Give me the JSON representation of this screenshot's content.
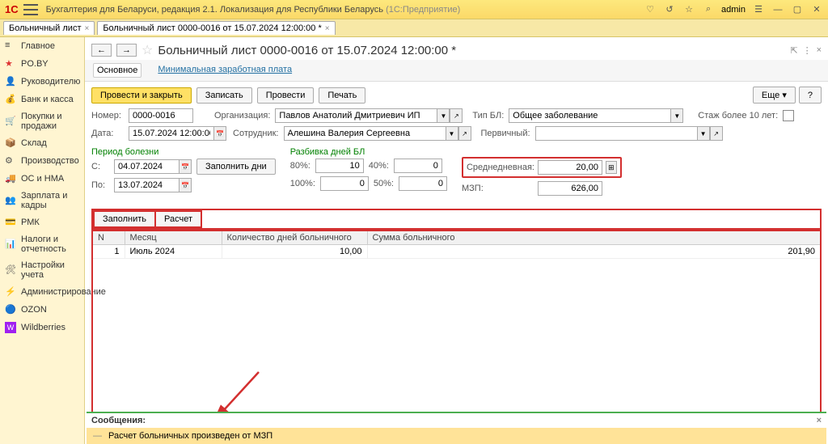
{
  "top": {
    "app": "Бухгалтерия для Беларуси, редакция 2.1. Локализация для Республики Беларусь",
    "suffix": "(1С:Предприятие)",
    "user": "admin"
  },
  "tabs": [
    "Больничный лист",
    "Больничный лист 0000-0016 от 15.07.2024 12:00:00 *"
  ],
  "sidebar": [
    "Главное",
    "PO.BY",
    "Руководителю",
    "Банк и касса",
    "Покупки и продажи",
    "Склад",
    "Производство",
    "ОС и НМА",
    "Зарплата и кадры",
    "РМК",
    "Налоги и отчетность",
    "Настройки учета",
    "Администрирование",
    "OZON",
    "Wildberries"
  ],
  "page_title": "Больничный лист 0000-0016 от 15.07.2024 12:00:00 *",
  "subtabs": {
    "main": "Основное",
    "link": "Минимальная заработная плата"
  },
  "buttons": {
    "post_close": "Провести и закрыть",
    "save": "Записать",
    "post": "Провести",
    "print": "Печать",
    "more": "Еще",
    "help": "?",
    "fill_days": "Заполнить дни",
    "fill": "Заполнить",
    "calc": "Расчет"
  },
  "labels": {
    "number": "Номер:",
    "date": "Дата:",
    "org": "Организация:",
    "emp": "Сотрудник:",
    "type": "Тип БЛ:",
    "primary": "Первичный:",
    "stazh": "Стаж более 10 лет:",
    "period": "Период болезни",
    "split": "Разбивка дней БЛ",
    "from": "С:",
    "to": "По:",
    "p80": "80%:",
    "p100": "100%:",
    "p40": "40%:",
    "p50": "50%:",
    "avg": "Среднедневная:",
    "mzp": "МЗП:"
  },
  "values": {
    "number": "0000-0016",
    "date": "15.07.2024 12:00:00",
    "org": "Павлов Анатолий Дмитриевич ИП",
    "emp": "Алешина Валерия Сергеевна",
    "type": "Общее заболевание",
    "primary": "",
    "from": "04.07.2024",
    "to": "13.07.2024",
    "p80": "10",
    "p100": "0",
    "p40": "0",
    "p50": "0",
    "avg": "20,00",
    "mzp": "626,00"
  },
  "grid": {
    "headers": [
      "N",
      "Месяц",
      "Количество дней больничного",
      "Сумма больничного"
    ],
    "rows": [
      {
        "n": "1",
        "month": "Июль 2024",
        "days": "10,00",
        "sum": "201,90"
      }
    ]
  },
  "messages": {
    "title": "Сообщения:",
    "text": "Расчет больничных произведен от МЗП"
  }
}
